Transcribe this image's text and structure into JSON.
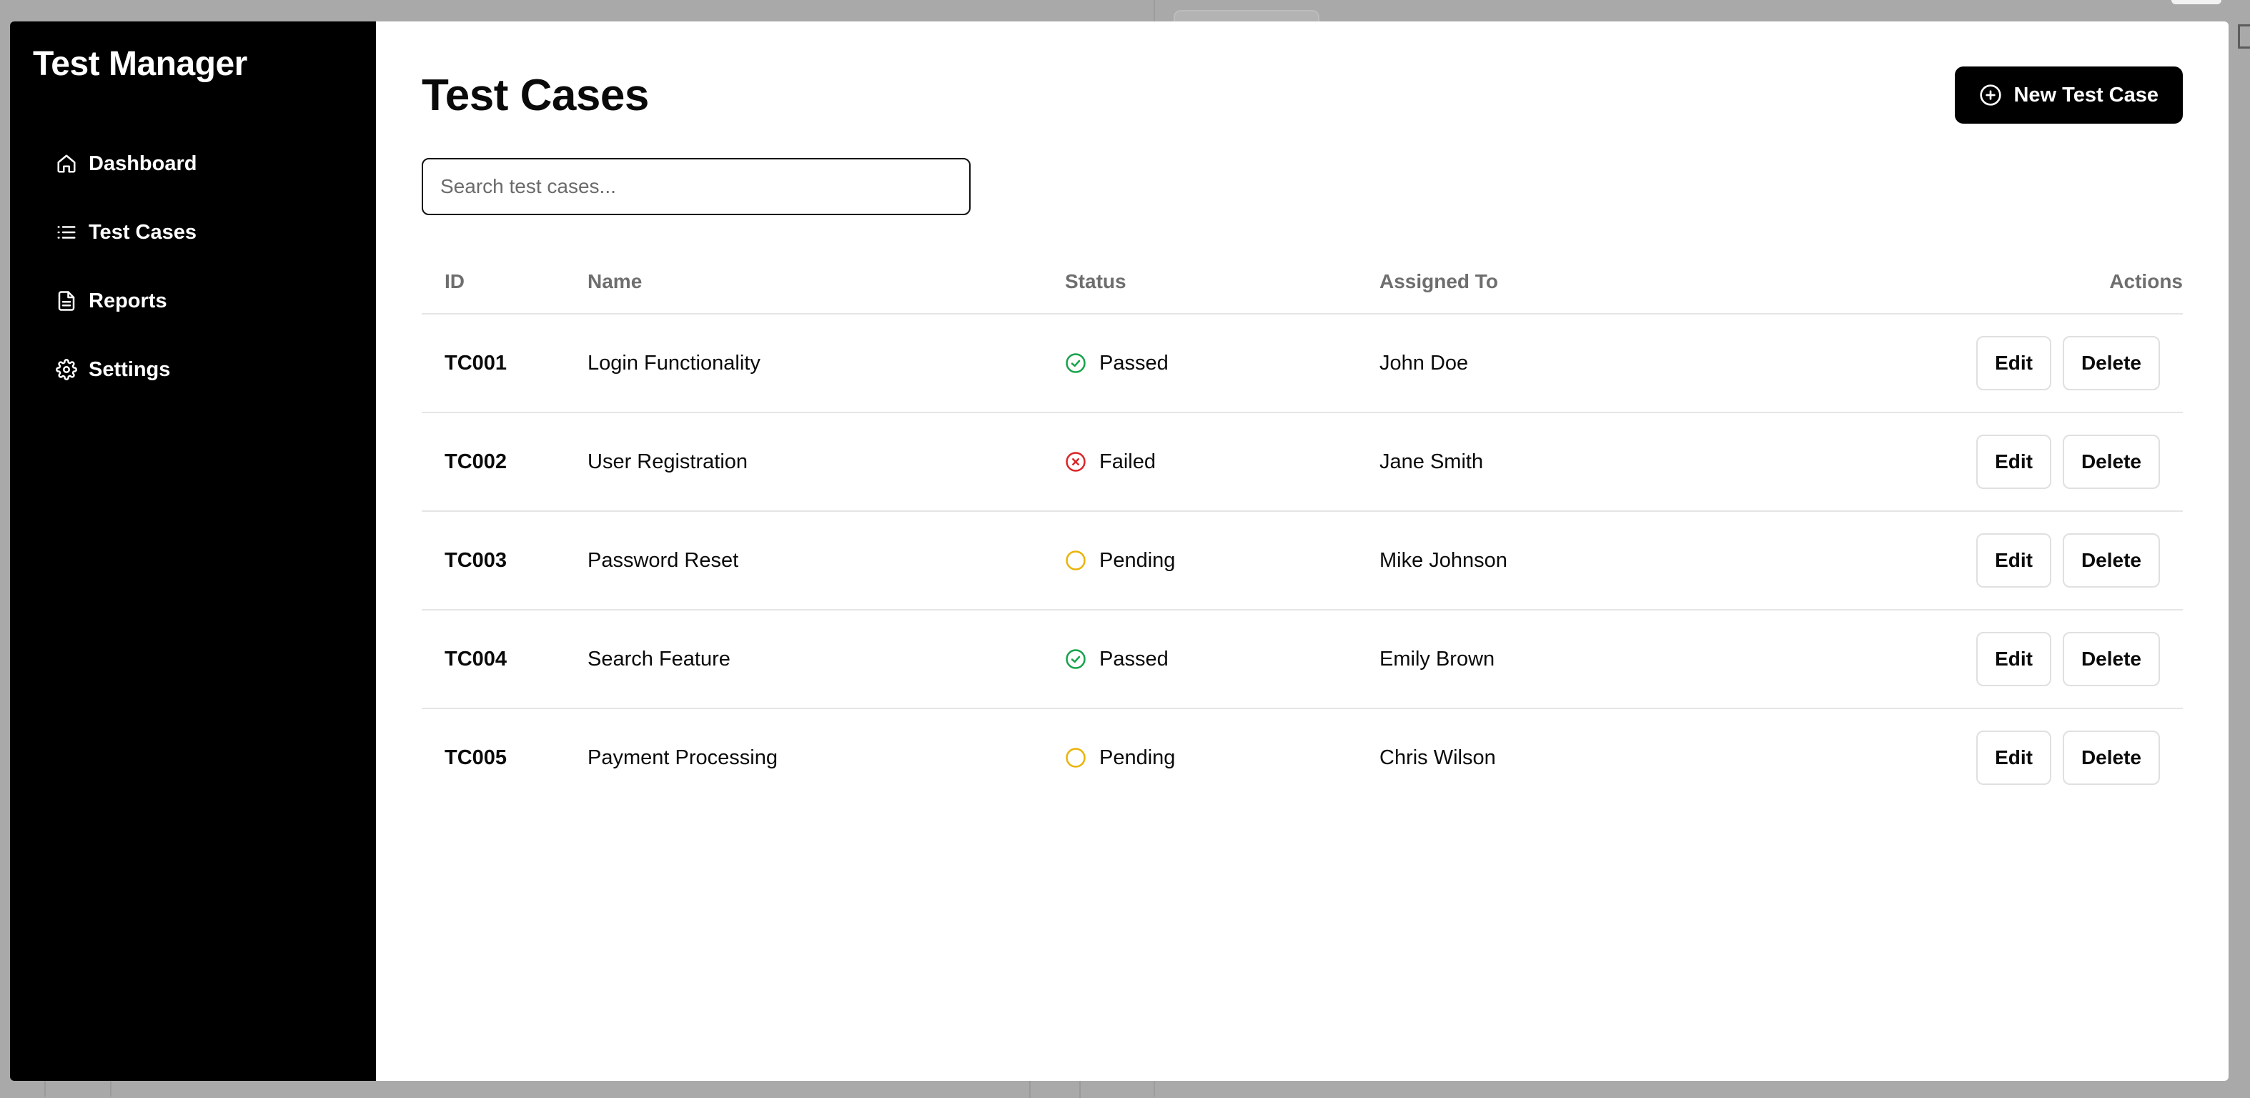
{
  "app": {
    "title": "Test Manager"
  },
  "sidebar": {
    "items": [
      {
        "label": "Dashboard",
        "icon": "home-icon"
      },
      {
        "label": "Test Cases",
        "icon": "list-icon"
      },
      {
        "label": "Reports",
        "icon": "document-icon"
      },
      {
        "label": "Settings",
        "icon": "gear-icon"
      }
    ]
  },
  "main": {
    "title": "Test Cases",
    "new_button_label": "New Test Case",
    "search_placeholder": "Search test cases..."
  },
  "table": {
    "headers": {
      "id": "ID",
      "name": "Name",
      "status": "Status",
      "assigned": "Assigned To",
      "actions": "Actions"
    },
    "rows": [
      {
        "id": "TC001",
        "name": "Login Functionality",
        "status": "Passed",
        "assigned": "John Doe",
        "edit": "Edit",
        "delete": "Delete"
      },
      {
        "id": "TC002",
        "name": "User Registration",
        "status": "Failed",
        "assigned": "Jane Smith",
        "edit": "Edit",
        "delete": "Delete"
      },
      {
        "id": "TC003",
        "name": "Password Reset",
        "status": "Pending",
        "assigned": "Mike Johnson",
        "edit": "Edit",
        "delete": "Delete"
      },
      {
        "id": "TC004",
        "name": "Search Feature",
        "status": "Passed",
        "assigned": "Emily Brown",
        "edit": "Edit",
        "delete": "Delete"
      },
      {
        "id": "TC005",
        "name": "Payment Processing",
        "status": "Pending",
        "assigned": "Chris Wilson",
        "edit": "Edit",
        "delete": "Delete"
      }
    ]
  },
  "colors": {
    "sidebar_bg": "#000000",
    "passed": "#16a34a",
    "failed": "#dc2626",
    "pending": "#eab308"
  }
}
